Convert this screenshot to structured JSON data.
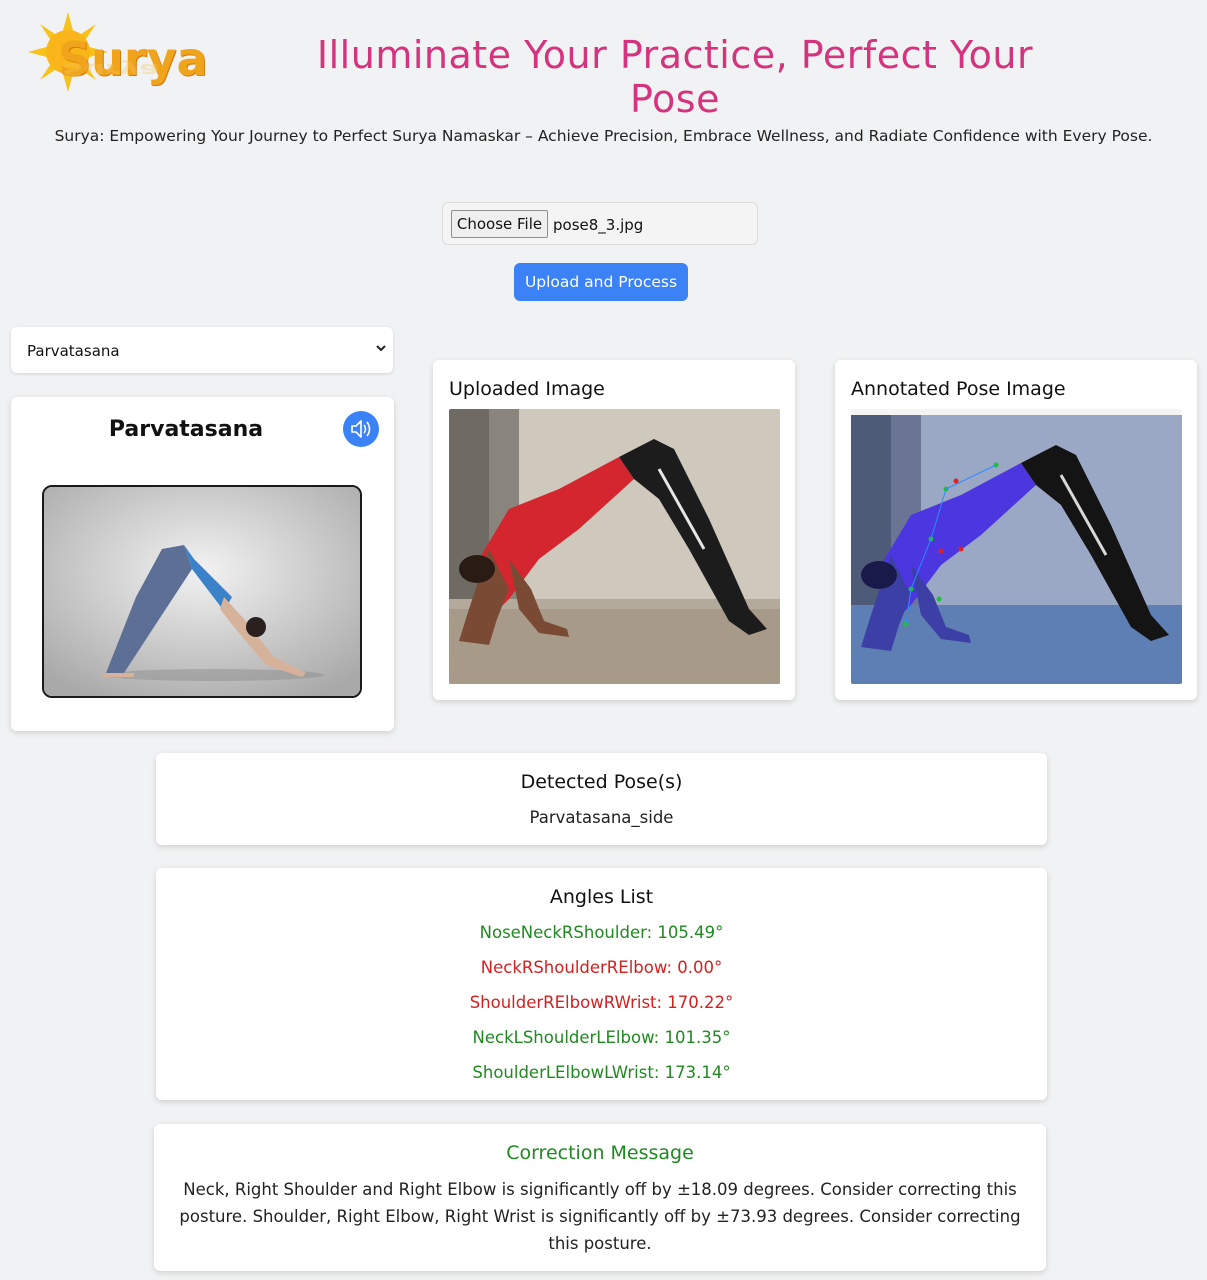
{
  "logo": {
    "text": "Surya"
  },
  "header": {
    "headline": "Illuminate Your Practice, Perfect Your Pose",
    "subtitle": "Surya: Empowering Your Journey to Perfect Surya Namaskar – Achieve Precision, Embrace Wellness, and Radiate Confidence with Every Pose."
  },
  "upload": {
    "choose_label": "Choose File",
    "file_name": "pose8_3.jpg",
    "submit_label": "Upload and Process"
  },
  "pose_select": {
    "value": "Parvatasana",
    "icon": "chevron-down-icon"
  },
  "reference": {
    "title": "Parvatasana",
    "speaker_icon": "speaker-icon"
  },
  "uploaded": {
    "title": "Uploaded Image"
  },
  "annotated": {
    "title": "Annotated Pose Image"
  },
  "detected": {
    "title": "Detected Pose(s)",
    "value": "Parvatasana_side"
  },
  "angles": {
    "title": "Angles List",
    "items": [
      {
        "text": "NoseNeckRShoulder: 105.49°",
        "color": "#1f8a1f"
      },
      {
        "text": "NeckRShoulderRElbow: 0.00°",
        "color": "#d62020"
      },
      {
        "text": "ShoulderRElbowRWrist: 170.22°",
        "color": "#d62020"
      },
      {
        "text": "NeckLShoulderLElbow: 101.35°",
        "color": "#1f8a1f"
      },
      {
        "text": "ShoulderLElbowLWrist: 173.14°",
        "color": "#1f8a1f"
      }
    ]
  },
  "correction": {
    "title": "Correction Message",
    "text": "Neck, Right Shoulder and Right Elbow is significantly off by ±18.09 degrees. Consider correcting this posture. Shoulder, Right Elbow, Right Wrist is significantly off by ±73.93 degrees. Consider correcting this posture."
  },
  "colors": {
    "accent": "#d6337f",
    "button": "#3b82f6",
    "ok": "#1f8a1f",
    "bad": "#d62020"
  }
}
